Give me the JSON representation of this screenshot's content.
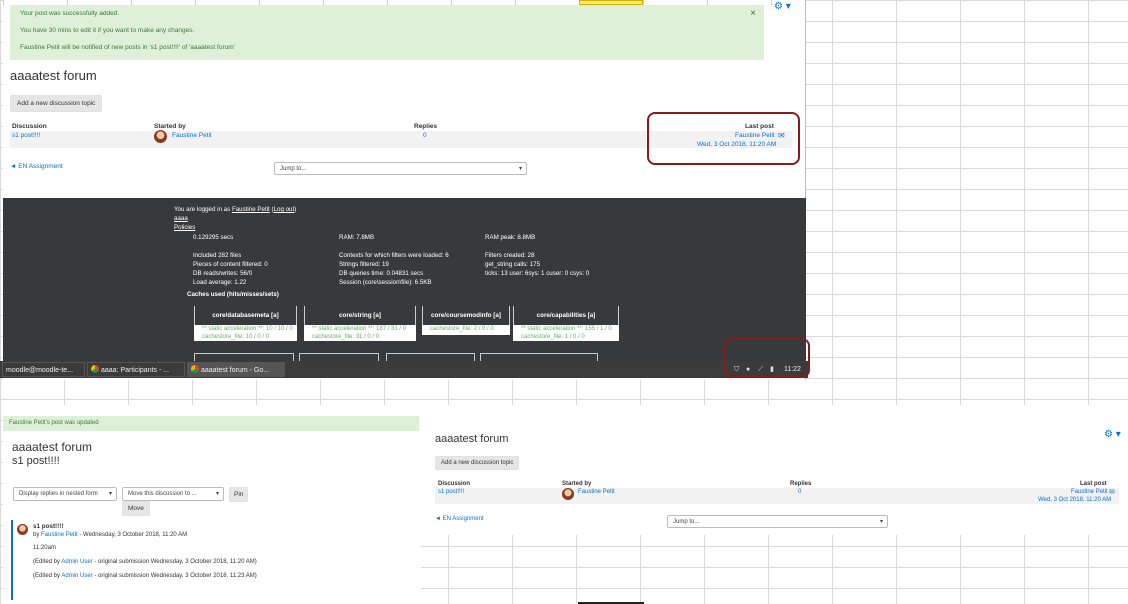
{
  "win1": {
    "alert_line1": "Your post was successfully added.",
    "alert_line2": "You have 30 mins to edit it if you want to make any changes.",
    "alert_line3": "Faustine Petit will be notified of new posts in 's1 post!!!!' of 'aaaatest forum'",
    "close": "×",
    "gear": "⚙ ▾",
    "title": "aaaatest forum",
    "add_btn": "Add a new discussion topic",
    "col_discussion": "Discussion",
    "col_started": "Started by",
    "col_replies": "Replies",
    "col_last": "Last post",
    "row_discussion": "s1 post!!!!",
    "row_started": "Faustine Petit",
    "row_replies": "0",
    "row_last_name": "Faustine Petit",
    "row_last_date": "Wed, 3 Oct 2018, 11:20 AM",
    "back_link": "◄ EN Assignment",
    "jump": "Jump to..."
  },
  "footer1": {
    "logged_pre": "You are logged in as",
    "logged_user": "Faustine Petit",
    "logout": "Log out",
    "link_aaaa": "aaaa",
    "link_policies": "Policies",
    "col1": [
      "0.129295 secs",
      "",
      "Included 282 files",
      "Pieces of content filtered: 0",
      "DB reads/writes: 56/0",
      "Load average: 1.22"
    ],
    "col2": [
      "RAM: 7.8MB",
      "",
      "Contexts for which filters were loaded: 6",
      "Strings filtered: 19",
      "DB queries time: 0.04831 secs",
      "Session (core\\session\\file): 6.5KB"
    ],
    "col3": [
      "RAM peak: 8.8MB",
      "",
      "Filters created: 28",
      "get_string calls: 175",
      "ticks: 13 user: 6sys: 1 cuser: 0 csys: 0"
    ],
    "caches_heading": "Caches used (hits/misses/sets)",
    "caches": [
      {
        "title": "core/databasemeta [a]",
        "l1": "** static acceleration **: 10 / 10 / 0",
        "l2": "cachestore_file: 10 / 0 / 0"
      },
      {
        "title": "core/string [a]",
        "l1": "** static acceleration **: 187 / 31 / 0",
        "l2": "cachestore_file: 31 / 0 / 0"
      },
      {
        "title": "core/coursemodinfo [a]",
        "l1": "cachestore_file: 2 / 0 / 0",
        "l2": ""
      },
      {
        "title": "core/capabilities [a]",
        "l1": "** static acceleration **: 155 / 1 / 0",
        "l2": "cachestore_file: 1 / 0 / 0"
      }
    ]
  },
  "taskbar": {
    "t1": "moodle@moodle-te...",
    "t2": "aaaa: Participants - ...",
    "t3": "aaaatest forum - Go...",
    "clock": "11:22"
  },
  "win2": {
    "alert": "Faustine Petit's post was updated",
    "title": "aaaatest forum",
    "subtitle": "s1 post!!!!",
    "display_select": "Display replies in nested form",
    "move_select": "Move this discussion to ...",
    "pin": "Pin",
    "move": "Move",
    "post_subject": "s1 post!!!!",
    "by": "by",
    "author": "Faustine Petit",
    "post_date": "- Wednesday, 3 October 2018, 11:20 AM",
    "body": "11:20am",
    "edit1_pre": "(Edited by",
    "edit1_user": "Admin User",
    "edit1_post": "- original submission Wednesday, 3 October 2018, 11:20 AM)",
    "edit2_pre": "(Edited by",
    "edit2_user": "Admin User",
    "edit2_post": "- original submission Wednesday, 3 October 2018, 11:23 AM)"
  },
  "win3": {
    "title": "aaaatest forum",
    "gear": "⚙ ▾",
    "add_btn": "Add a new discussion topic",
    "col_discussion": "Discussion",
    "col_started": "Started by",
    "col_replies": "Replies",
    "col_last": "Last post",
    "row_discussion": "s1 post!!!!",
    "row_started": "Faustine Petit",
    "row_replies": "0",
    "row_last_name": "Faustine Petit",
    "row_last_date": "Wed, 3 Oct 2018, 11:20 AM",
    "back_link": "◄ EN Assignment",
    "jump": "Jump to..."
  },
  "colors": {
    "link": "#0a6fcc",
    "success_bg": "#dff0d8",
    "success_text": "#3c763d",
    "footer_bg": "#373a3c",
    "highlight_box": "#8b1a1a"
  }
}
